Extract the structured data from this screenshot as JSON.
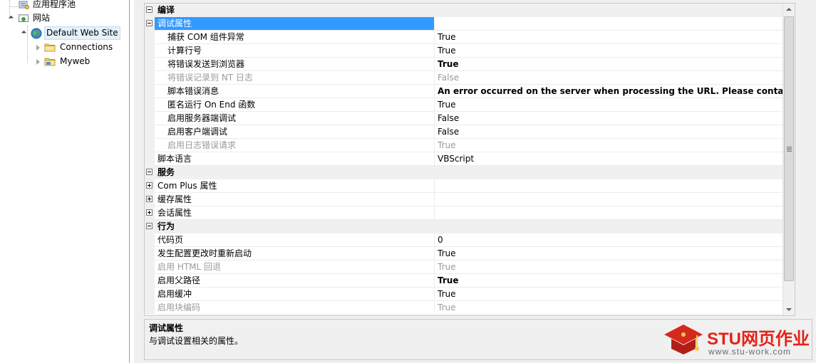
{
  "tree": {
    "items": [
      {
        "label": "应用程序池",
        "icon": "app-pool-icon"
      },
      {
        "label": "网站",
        "icon": "sites-icon"
      },
      {
        "label": "Default Web Site",
        "icon": "globe-icon"
      },
      {
        "label": "Connections",
        "icon": "folder-icon"
      },
      {
        "label": "Myweb",
        "icon": "folder-icon"
      }
    ]
  },
  "grid": {
    "compile": "编译",
    "debug": "调试属性",
    "rows": [
      {
        "name": "捕获 COM 组件异常",
        "value": "True"
      },
      {
        "name": "计算行号",
        "value": "True"
      },
      {
        "name": "将错误发送到浏览器",
        "value": "True"
      },
      {
        "name": "将错误记录到 NT 日志",
        "value": "False"
      },
      {
        "name": "脚本错误消息",
        "value": "An error occurred on the server when processing the URL. Please contact the syst"
      },
      {
        "name": "匿名运行 On End 函数",
        "value": "True"
      },
      {
        "name": "启用服务器端调试",
        "value": "False"
      },
      {
        "name": "启用客户端调试",
        "value": "False"
      },
      {
        "name": "启用日志错误请求",
        "value": "True"
      },
      {
        "name": "脚本语言",
        "value": "VBScript"
      }
    ],
    "services": "服务",
    "service_items": [
      {
        "name": "Com Plus 属性"
      },
      {
        "name": "缓存属性"
      },
      {
        "name": "会话属性"
      }
    ],
    "behavior": "行为",
    "behavior_rows": [
      {
        "name": "代码页",
        "value": "0"
      },
      {
        "name": "发生配置更改时重新启动",
        "value": "True"
      },
      {
        "name": "启用 HTML 回退",
        "value": "True"
      },
      {
        "name": "启用父路径",
        "value": "True"
      },
      {
        "name": "启用缓冲",
        "value": "True"
      },
      {
        "name": "启用块编码",
        "value": "True"
      }
    ]
  },
  "description": {
    "title": "调试属性",
    "text": "与调试设置相关的属性。"
  },
  "watermark": {
    "brand_latin": "STU",
    "brand_cn": "网页作业",
    "url": "www.stu-work.com"
  },
  "colors": {
    "selection": "#3399ff",
    "category_bg": "#f0f0f0",
    "watermark_red": "#e32219"
  }
}
